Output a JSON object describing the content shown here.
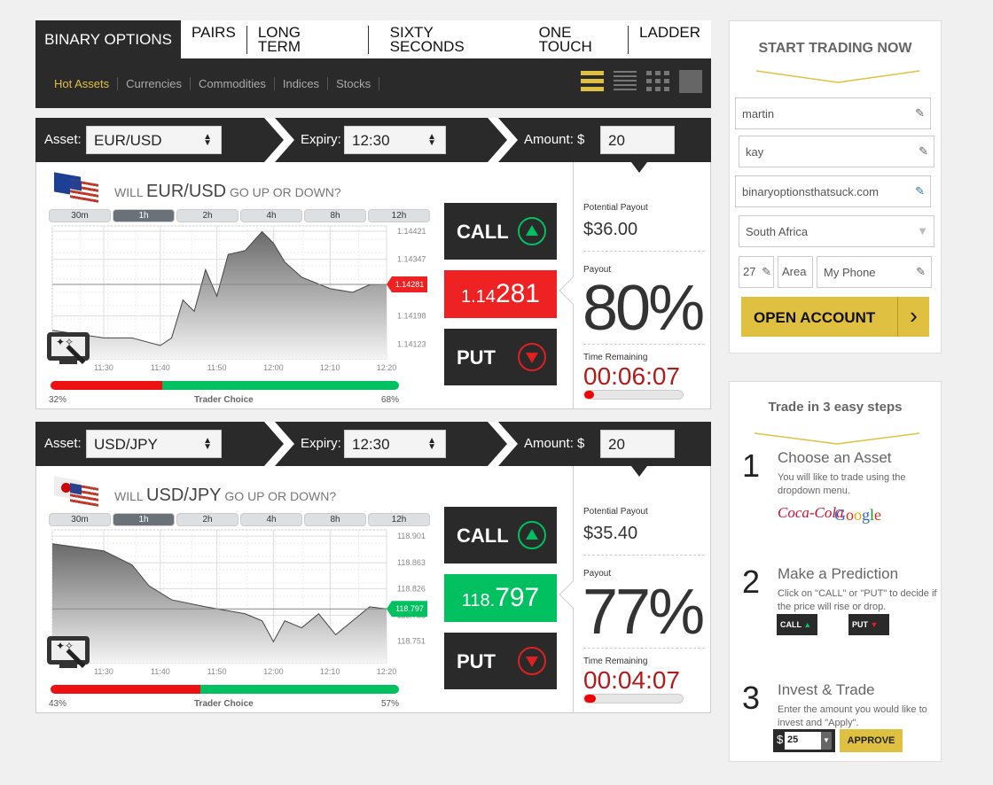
{
  "nav": {
    "main_tab": "BINARY OPTIONS",
    "tabs": [
      "PAIRS",
      "LONG TERM",
      "SIXTY SECONDS",
      "ONE TOUCH",
      "LADDER"
    ],
    "subtabs": [
      "Hot Assets",
      "Currencies",
      "Commodities",
      "Indices",
      "Stocks"
    ],
    "active_subtab": "Hot Assets"
  },
  "colors": {
    "accent": "#e0c040",
    "dark": "#2a2a2a",
    "red": "#ee2222",
    "green": "#00c060",
    "deep_red": "#b01c1c"
  },
  "panels": [
    {
      "asset_label": "Asset:",
      "asset": "EUR/USD",
      "expiry_label": "Expiry:",
      "expiry": "12:30",
      "amount_label": "Amount: $",
      "amount": "20",
      "q_pre": "WILL",
      "q_asset": "EUR/USD",
      "q_post": "GO UP OR DOWN?",
      "ranges": [
        "30m",
        "1h",
        "2h",
        "4h",
        "8h",
        "12h"
      ],
      "active_range": "1h",
      "call": "CALL",
      "put": "PUT",
      "price_small": "1.14",
      "price_big": "281",
      "price_tag": "1.14281",
      "price_dir": "down",
      "y_ticks": [
        "1.14421",
        "1.14347",
        "1.14198",
        "1.14123"
      ],
      "x_ticks": [
        "11:30",
        "11:40",
        "11:50",
        "12:00",
        "12:10",
        "12:20"
      ],
      "left_pct": "32%",
      "right_pct": "68%",
      "put_share": 32,
      "choice_label": "Trader Choice",
      "pp_label": "Potential Payout",
      "pp": "$36.00",
      "payout_label": "Payout",
      "payout": "80%",
      "tr_label": "Time Remaining",
      "tr": "00:06:07",
      "time_fraction": 0.1
    },
    {
      "asset_label": "Asset:",
      "asset": "USD/JPY",
      "expiry_label": "Expiry:",
      "expiry": "12:30",
      "amount_label": "Amount: $",
      "amount": "20",
      "q_pre": "WILL",
      "q_asset": "USD/JPY",
      "q_post": "GO UP OR DOWN?",
      "ranges": [
        "30m",
        "1h",
        "2h",
        "4h",
        "8h",
        "12h"
      ],
      "active_range": "1h",
      "call": "CALL",
      "put": "PUT",
      "price_small": "118.",
      "price_big": "797",
      "price_tag": "118.797",
      "price_dir": "up",
      "y_ticks": [
        "118.901",
        "118.863",
        "118.826",
        "118.788",
        "118.751"
      ],
      "x_ticks": [
        "11:30",
        "11:40",
        "11:50",
        "12:00",
        "12:10",
        "12:20"
      ],
      "left_pct": "43%",
      "right_pct": "57%",
      "put_share": 43,
      "choice_label": "Trader Choice",
      "pp_label": "Potential Payout",
      "pp": "$35.40",
      "payout_label": "Payout",
      "payout": "77%",
      "tr_label": "Time Remaining",
      "tr": "00:04:07",
      "time_fraction": 0.12
    }
  ],
  "chart_data": [
    {
      "type": "area",
      "title": "EUR/USD",
      "x": [
        "11:26",
        "11:30",
        "11:35",
        "11:40",
        "11:42",
        "11:44",
        "11:46",
        "11:48",
        "11:50",
        "11:52",
        "11:55",
        "11:58",
        "12:00",
        "12:02",
        "12:05",
        "12:10",
        "12:14",
        "12:17",
        "12:20"
      ],
      "values": [
        1.1416,
        1.1414,
        1.1414,
        1.1412,
        1.1414,
        1.1424,
        1.1421,
        1.1432,
        1.1425,
        1.1436,
        1.1437,
        1.1442,
        1.1439,
        1.1434,
        1.143,
        1.1427,
        1.1426,
        1.1428,
        1.14281
      ],
      "ylim": [
        1.14085,
        1.14435
      ]
    },
    {
      "type": "area",
      "title": "USD/JPY",
      "x": [
        "11:24",
        "11:30",
        "11:35",
        "11:38",
        "11:42",
        "11:48",
        "11:55",
        "11:58",
        "12:00",
        "12:02",
        "12:05",
        "12:08",
        "12:11",
        "12:14",
        "12:17",
        "12:20"
      ],
      "values": [
        118.89,
        118.88,
        118.86,
        118.83,
        118.81,
        118.8,
        118.79,
        118.78,
        118.75,
        118.78,
        118.77,
        118.79,
        118.76,
        118.78,
        118.8,
        118.797
      ],
      "ylim": [
        118.72,
        118.91
      ]
    }
  ],
  "signup": {
    "title": "START TRADING NOW",
    "first": "martin",
    "last": "kay",
    "email": "binaryoptionsthatsuck.com",
    "country": "South Africa",
    "code": "27",
    "area": "Area",
    "phone": "My Phone",
    "button": "OPEN ACCOUNT"
  },
  "steps": {
    "title": "Trade in 3 easy steps",
    "items": [
      {
        "n": "1",
        "title": "Choose an Asset",
        "desc": "You will like to trade using the dropdown menu."
      },
      {
        "n": "2",
        "title": "Make a Prediction",
        "desc": "Click on \"CALL\" or \"PUT\" to decide if the price will rise or drop."
      },
      {
        "n": "3",
        "title": "Invest & Trade",
        "desc": "Enter the amount you would like to invest and \"Apply\"."
      }
    ],
    "logos": [
      "Coca-Cola",
      "Google"
    ],
    "call": "CALL",
    "put": "PUT",
    "currency": "$",
    "amount": "25",
    "approve": "APPROVE"
  }
}
